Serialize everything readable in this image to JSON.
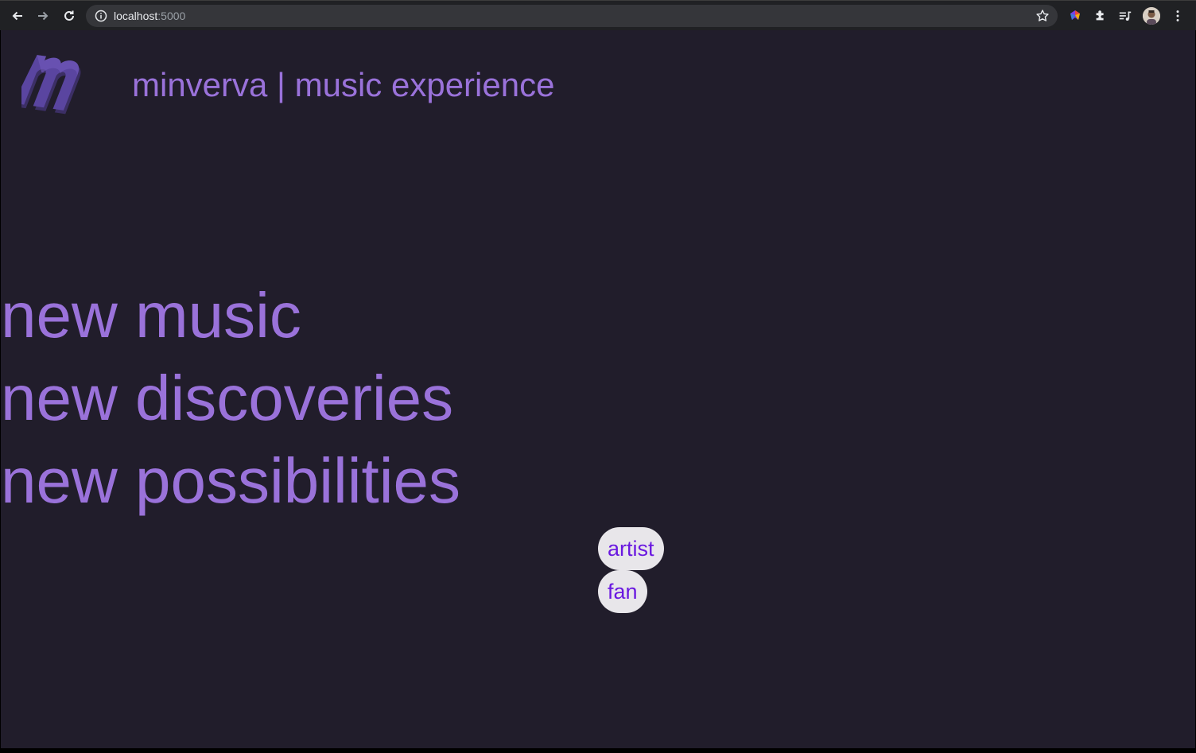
{
  "browser": {
    "url_host": "localhost",
    "url_port": ":5000"
  },
  "header": {
    "title": "minverva | music experience",
    "logo_icon": "m-logo-icon"
  },
  "hero": {
    "lines": [
      "new music",
      "new discoveries",
      "new possibilities"
    ]
  },
  "roles": {
    "artist_label": "artist",
    "fan_label": "fan"
  },
  "colors": {
    "background": "#211d2b",
    "accent": "#9a72da",
    "button_bg": "#e8e6ea",
    "button_text": "#6a18e0"
  }
}
